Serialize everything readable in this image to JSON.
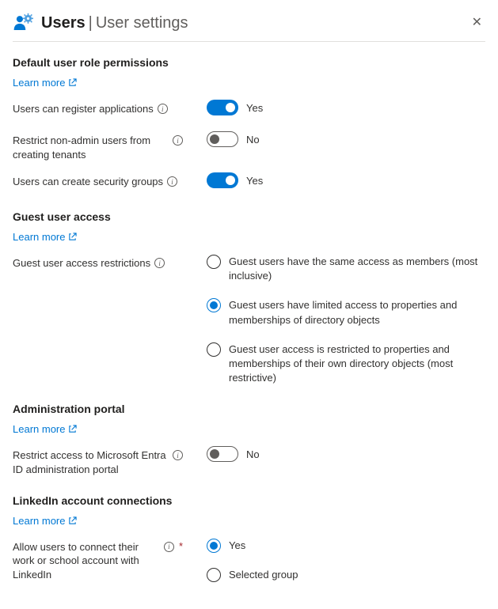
{
  "header": {
    "title": "Users",
    "separator": "|",
    "subtitle": "User settings"
  },
  "sections": {
    "default_role": {
      "heading": "Default user role permissions",
      "learn_more": "Learn more",
      "register_apps": {
        "label": "Users can register applications",
        "value_label": "Yes",
        "on": true
      },
      "restrict_tenants": {
        "label": "Restrict non-admin users from creating tenants",
        "value_label": "No",
        "on": false
      },
      "security_groups": {
        "label": "Users can create security groups",
        "value_label": "Yes",
        "on": true
      }
    },
    "guest": {
      "heading": "Guest user access",
      "learn_more": "Learn more",
      "restrictions_label": "Guest user access restrictions",
      "options": [
        "Guest users have the same access as members (most inclusive)",
        "Guest users have limited access to properties and memberships of directory objects",
        "Guest user access is restricted to properties and memberships of their own directory objects (most restrictive)"
      ],
      "selected_index": 1
    },
    "admin_portal": {
      "heading": "Administration portal",
      "learn_more": "Learn more",
      "restrict_portal": {
        "label": "Restrict access to Microsoft Entra ID administration portal",
        "value_label": "No",
        "on": false
      }
    },
    "linkedin": {
      "heading": "LinkedIn account connections",
      "learn_more": "Learn more",
      "allow_label": "Allow users to connect their work or school account with LinkedIn",
      "options": [
        "Yes",
        "Selected group"
      ],
      "selected_index": 0
    }
  }
}
